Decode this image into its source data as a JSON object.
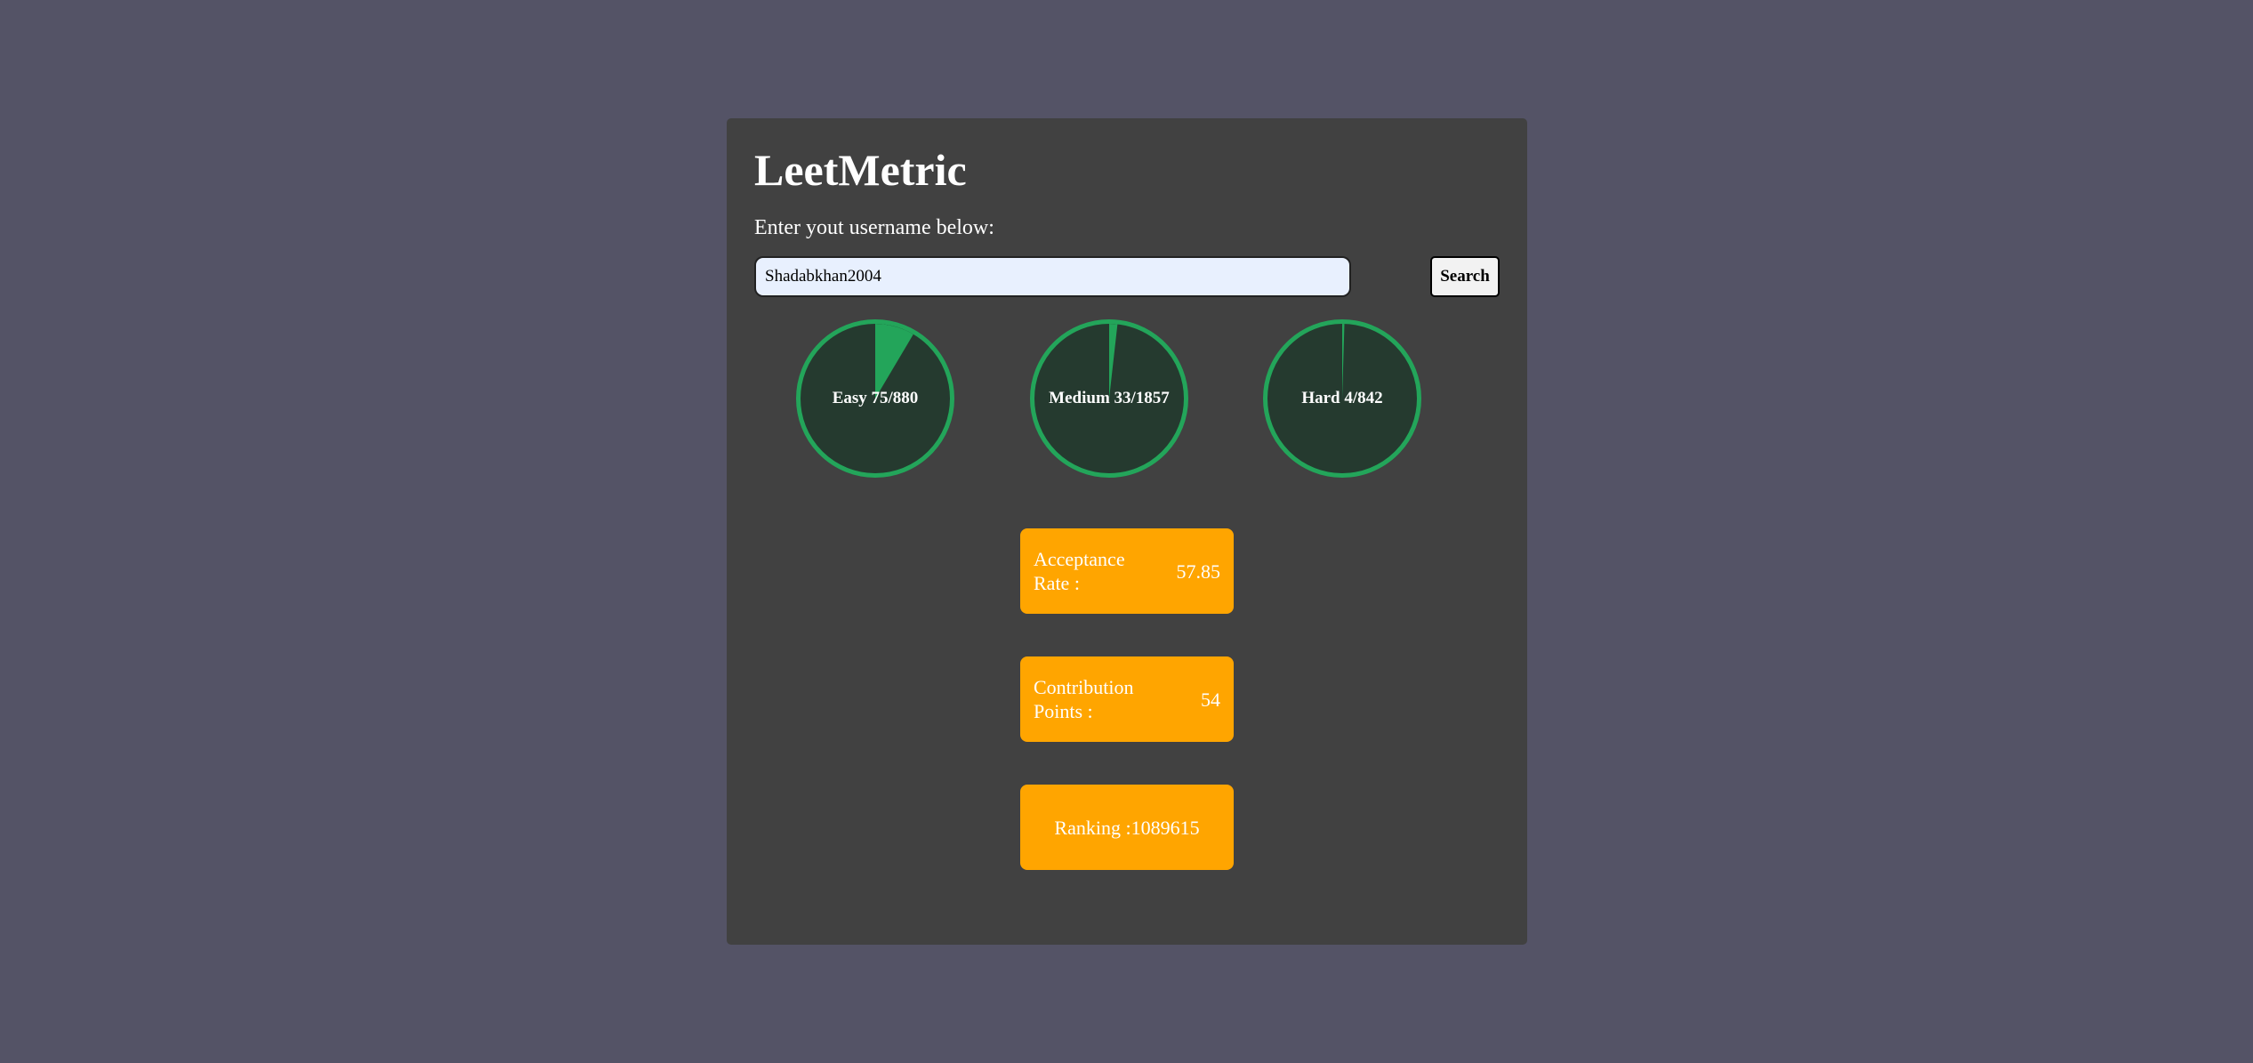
{
  "app": {
    "title": "LeetMetric"
  },
  "search": {
    "prompt": "Enter yout username below:",
    "value": "Shadabkhan2004",
    "button_label": "Search"
  },
  "progress": [
    {
      "label": "Easy",
      "solved": 75,
      "total": 880,
      "text": "Easy 75/880"
    },
    {
      "label": "Medium",
      "solved": 33,
      "total": 1857,
      "text": "Medium 33/1857"
    },
    {
      "label": "Hard",
      "solved": 4,
      "total": 842,
      "text": "Hard 4/842"
    }
  ],
  "stats": {
    "acceptance": {
      "label": "Acceptance Rate :",
      "value": "57.85"
    },
    "contribution": {
      "label": "Contribution Points :",
      "value": "54"
    },
    "ranking": {
      "text": "Ranking :1089615"
    }
  },
  "colors": {
    "page_bg": "#545366",
    "card_bg": "#414141",
    "progress_fill": "#23a55a",
    "circle_bg": "#253a2f",
    "stat_bg": "#ffa500"
  }
}
